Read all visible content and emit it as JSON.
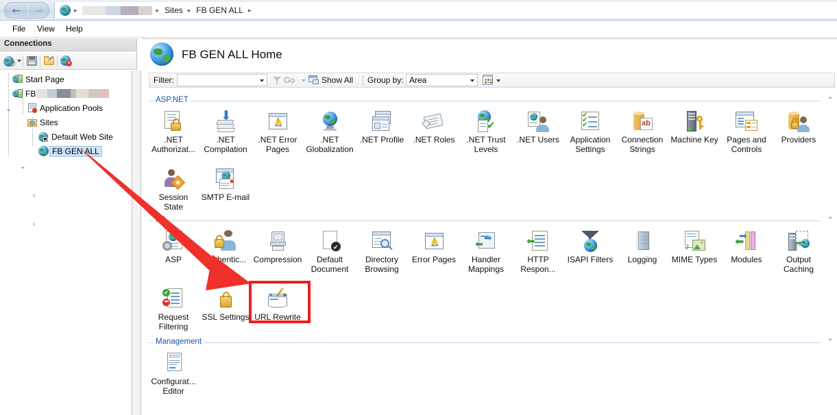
{
  "window": {
    "breadcrumb": {
      "globe_icon": "globe-icon",
      "redacted_server": "",
      "items": [
        "Sites",
        "FB GEN ALL"
      ],
      "back_arrow": "←",
      "forward_arrow": "→",
      "separator": "▸"
    },
    "menu": [
      "File",
      "View",
      "Help"
    ]
  },
  "connections": {
    "title": "Connections",
    "toolbar": [
      {
        "name": "connect-to-icon",
        "icon": "globe-search-icon"
      },
      {
        "name": "save-connections-icon",
        "icon": "floppy-icon"
      },
      {
        "name": "export-icon",
        "icon": "folder-pencil-icon"
      },
      {
        "name": "disconnect-icon",
        "icon": "globe-delete-icon"
      }
    ],
    "tree": [
      {
        "label": "Start Page",
        "icon": "start-page-icon",
        "indent": 0,
        "twisty": "",
        "selected": false
      },
      {
        "label": "FB",
        "icon": "server-icon",
        "indent": 0,
        "twisty": "⌄",
        "selected": false,
        "redacted": true
      },
      {
        "label": "Application Pools",
        "icon": "app-pools-icon",
        "indent": 1,
        "twisty": "",
        "selected": false
      },
      {
        "label": "Sites",
        "icon": "sites-folder-icon",
        "indent": 1,
        "twisty": "⌄",
        "selected": false
      },
      {
        "label": "Default Web Site",
        "icon": "website-icon",
        "indent": 2,
        "twisty": "›",
        "selected": false
      },
      {
        "label": "FB GEN ALL",
        "icon": "website-globe-icon",
        "indent": 2,
        "twisty": "›",
        "selected": true
      }
    ]
  },
  "page": {
    "title": "FB GEN ALL Home",
    "title_icon": "globe-icon"
  },
  "filterbar": {
    "filter_label": "Filter:",
    "filter_value": "",
    "filter_placeholder": "",
    "go_label": "Go",
    "go_icon": "funnel-icon",
    "show_all_label": "Show All",
    "show_all_icon": "show-all-icon",
    "group_by_label": "Group by:",
    "group_by_value": "Area",
    "view_icon": "view-mode-icon"
  },
  "sections": [
    {
      "name": "ASP.NET",
      "chevron": "˄",
      "items": [
        {
          "label": ".NET Authorizat...",
          "icon": "net-authorization-icon"
        },
        {
          "label": ".NET Compilation",
          "icon": "net-compilation-icon"
        },
        {
          "label": ".NET Error Pages",
          "icon": "net-error-pages-icon"
        },
        {
          "label": ".NET Globalization",
          "icon": "net-globalization-icon"
        },
        {
          "label": ".NET Profile",
          "icon": "net-profile-icon"
        },
        {
          "label": ".NET Roles",
          "icon": "net-roles-icon"
        },
        {
          "label": ".NET Trust Levels",
          "icon": "net-trust-levels-icon"
        },
        {
          "label": ".NET Users",
          "icon": "net-users-icon"
        },
        {
          "label": "Application Settings",
          "icon": "application-settings-icon"
        },
        {
          "label": "Connection Strings",
          "icon": "connection-strings-icon"
        },
        {
          "label": "Machine Key",
          "icon": "machine-key-icon"
        },
        {
          "label": "Pages and Controls",
          "icon": "pages-and-controls-icon"
        },
        {
          "label": "Providers",
          "icon": "providers-icon"
        },
        {
          "label": "Session State",
          "icon": "session-state-icon"
        },
        {
          "label": "SMTP E-mail",
          "icon": "smtp-email-icon"
        }
      ]
    },
    {
      "name": "IIS",
      "chevron": "˄",
      "items": [
        {
          "label": "ASP",
          "icon": "asp-icon"
        },
        {
          "label": "Authentic...",
          "icon": "authentication-icon"
        },
        {
          "label": "Compression",
          "icon": "compression-icon"
        },
        {
          "label": "Default Document",
          "icon": "default-document-icon"
        },
        {
          "label": "Directory Browsing",
          "icon": "directory-browsing-icon"
        },
        {
          "label": "Error Pages",
          "icon": "error-pages-icon"
        },
        {
          "label": "Handler Mappings",
          "icon": "handler-mappings-icon"
        },
        {
          "label": "HTTP Respon...",
          "icon": "http-response-headers-icon"
        },
        {
          "label": "ISAPI Filters",
          "icon": "isapi-filters-icon"
        },
        {
          "label": "Logging",
          "icon": "logging-icon"
        },
        {
          "label": "MIME Types",
          "icon": "mime-types-icon"
        },
        {
          "label": "Modules",
          "icon": "modules-icon"
        },
        {
          "label": "Output Caching",
          "icon": "output-caching-icon"
        },
        {
          "label": "Request Filtering",
          "icon": "request-filtering-icon"
        },
        {
          "label": "SSL Settings",
          "icon": "ssl-settings-icon"
        },
        {
          "label": "URL Rewrite",
          "icon": "url-rewrite-icon",
          "highlighted": true
        }
      ]
    },
    {
      "name": "Management",
      "chevron": "˄",
      "items": [
        {
          "label": "Configurat... Editor",
          "icon": "configuration-editor-icon"
        }
      ]
    }
  ],
  "annotations": {
    "arrow_color": "#f0302a",
    "highlight_color": "#f01d1d",
    "highlight_target": "URL Rewrite"
  }
}
